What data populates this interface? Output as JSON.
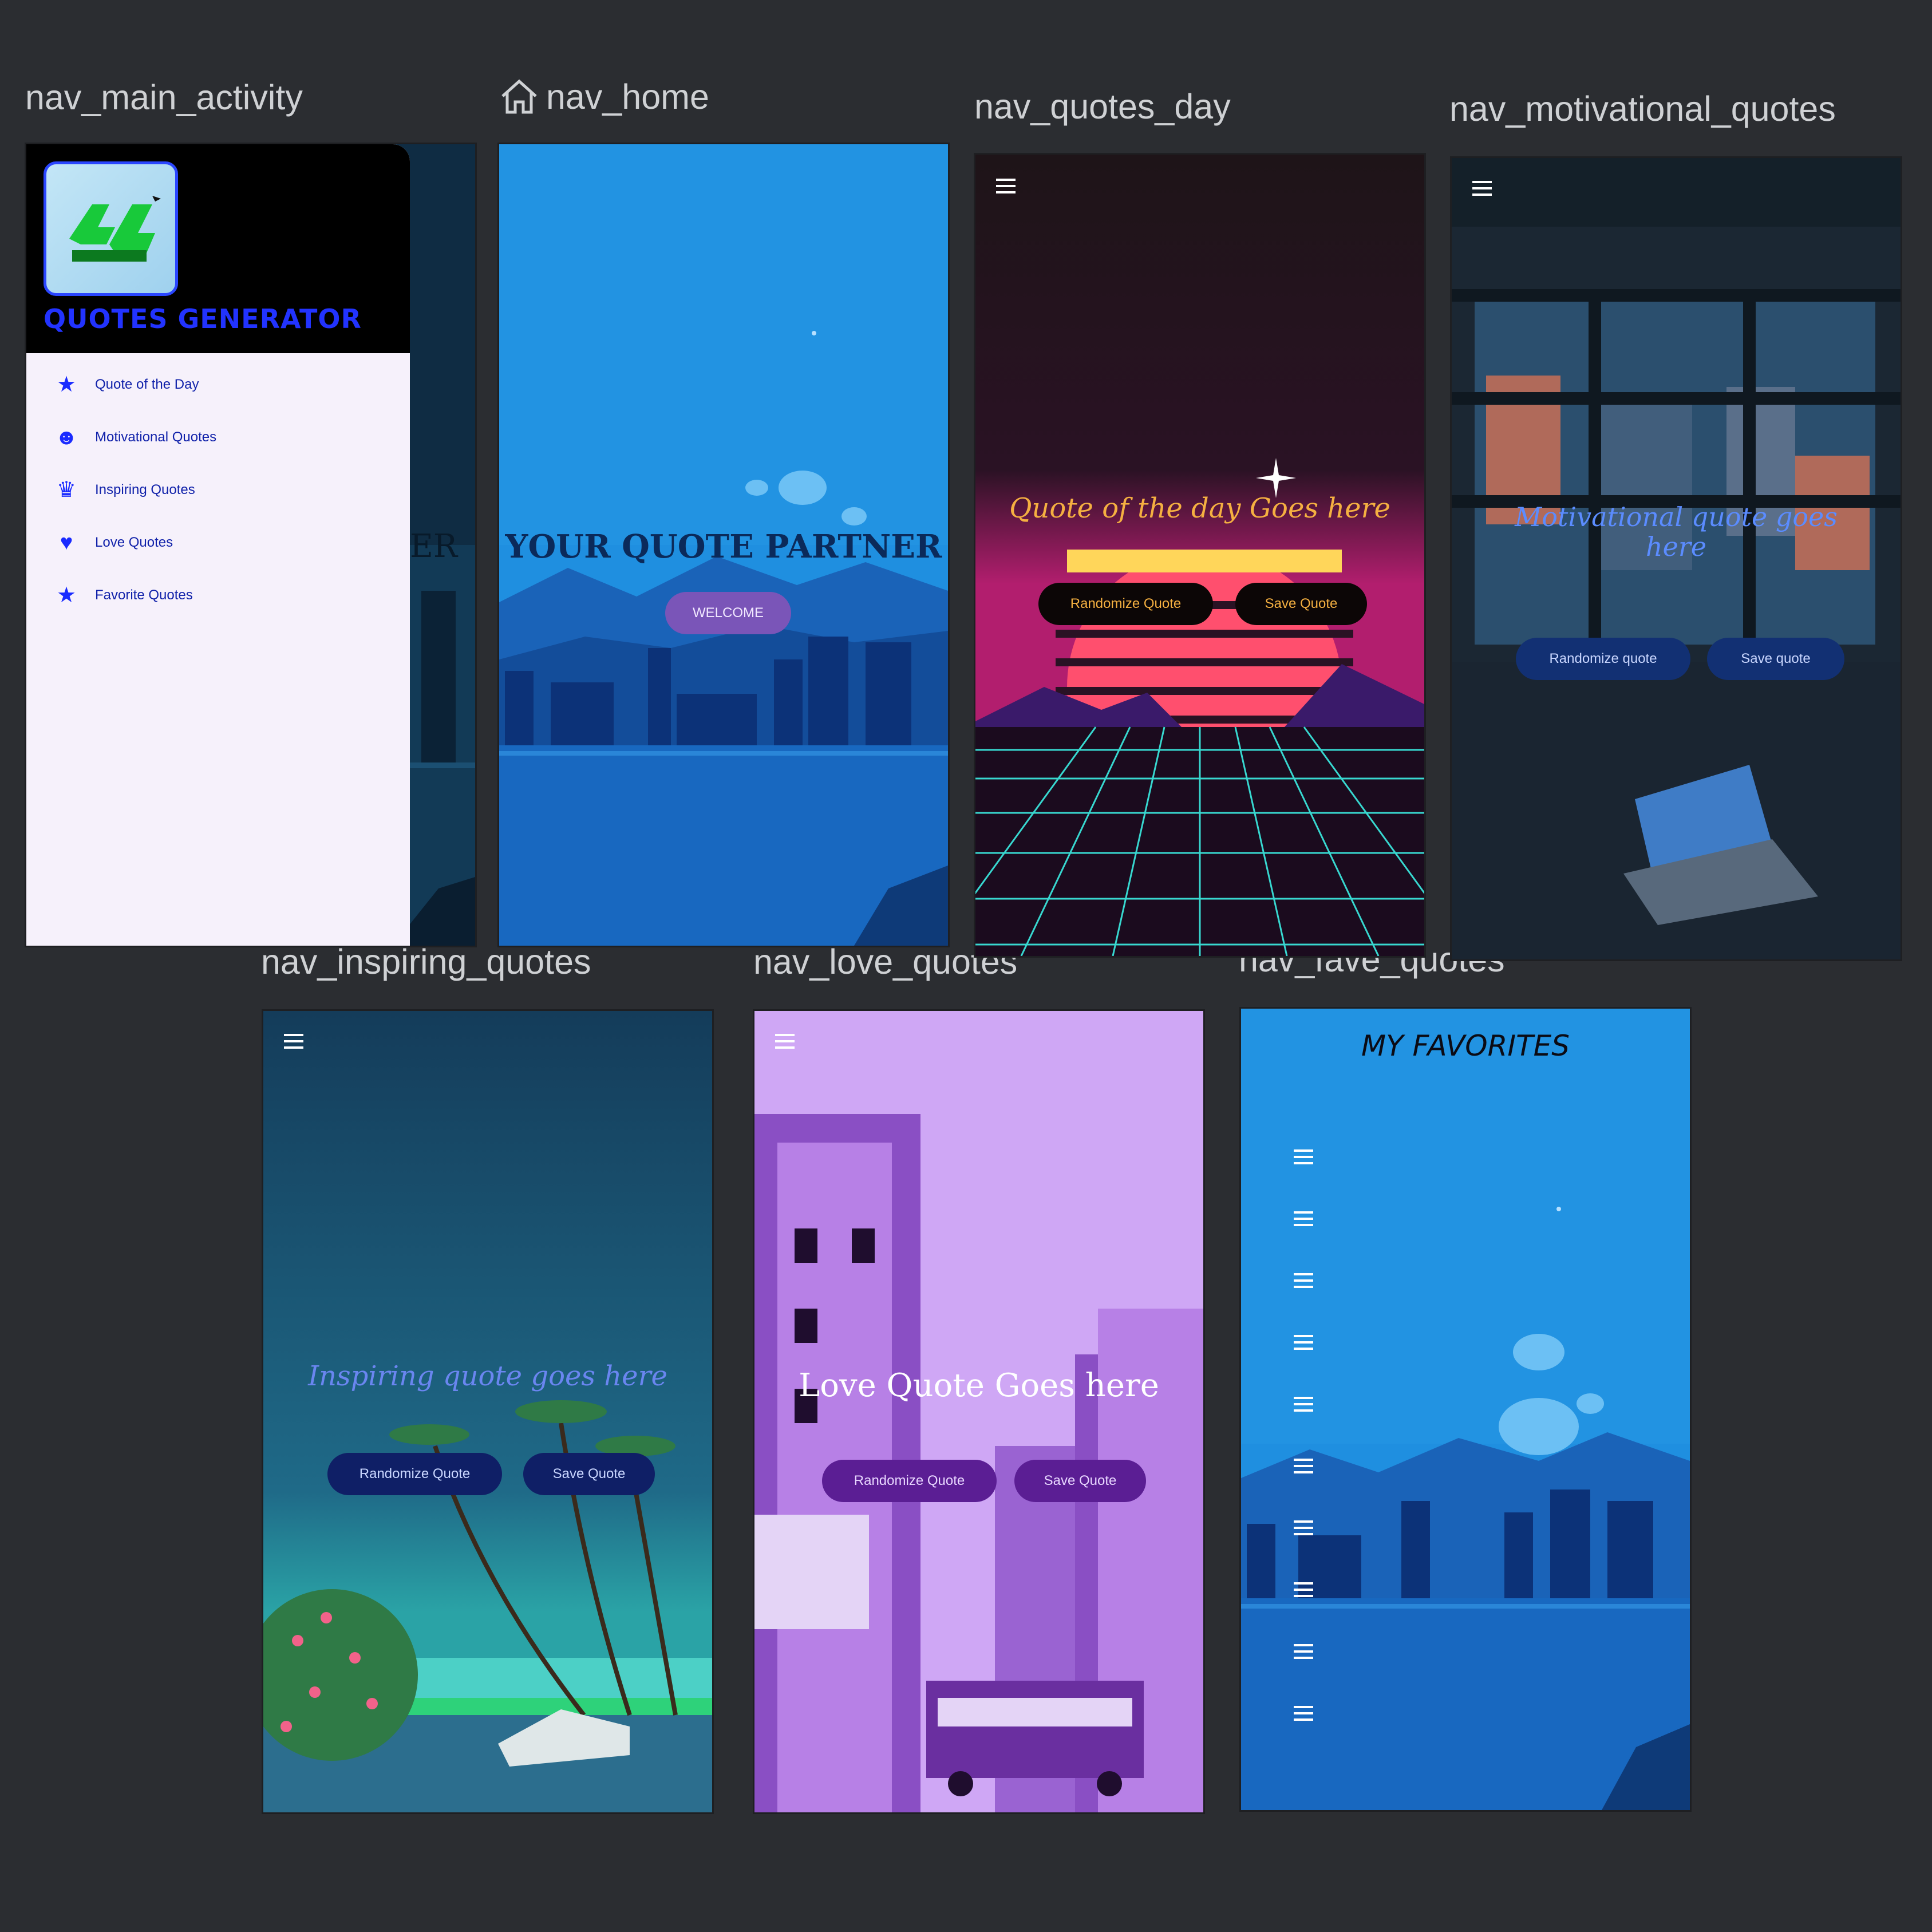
{
  "screens": {
    "main_activity": {
      "label": "nav_main_activity",
      "app_title": "QUOTES GENERATOR",
      "menu": [
        {
          "label": "Quote of the Day",
          "icon": "star-icon"
        },
        {
          "label": "Motivational Quotes",
          "icon": "person-icon"
        },
        {
          "label": "Inspiring Quotes",
          "icon": "heart-person-icon"
        },
        {
          "label": "Love Quotes",
          "icon": "heart-icon"
        },
        {
          "label": "Favorite Quotes",
          "icon": "star-icon"
        }
      ],
      "background_text": "ER"
    },
    "home": {
      "label": "nav_home",
      "title": "YOUR QUOTE PARTNER",
      "button": "WELCOME"
    },
    "quotes_day": {
      "label": "nav_quotes_day",
      "quote": "Quote of the day Goes here",
      "randomize": "Randomize Quote",
      "save": "Save Quote"
    },
    "motivational": {
      "label": "nav_motivational_quotes",
      "quote_line1": "Motivational quote goes",
      "quote_line2": "here",
      "randomize": "Randomize quote",
      "save": "Save quote"
    },
    "inspiring": {
      "label": "nav_inspiring_quotes",
      "quote": "Inspiring quote goes here",
      "randomize": "Randomize Quote",
      "save": "Save Quote"
    },
    "love": {
      "label": "nav_love_quotes",
      "quote": "Love Quote Goes here",
      "randomize": "Randomize Quote",
      "save": "Save Quote"
    },
    "fave": {
      "label": "nav_fave_quotes",
      "title": "MY FAVORITES"
    }
  },
  "colors": {
    "canvas": "#2b2d31",
    "home_bg": "#1f8fe0",
    "quotes_day_bg": "#1e1418",
    "motivational_bg": "#1d2b38",
    "inspiring_bg": "#1b4a6b",
    "love_bg": "#cfa7f5",
    "fave_bg": "#1f8fe0",
    "drawer_accent": "#2233ff"
  }
}
